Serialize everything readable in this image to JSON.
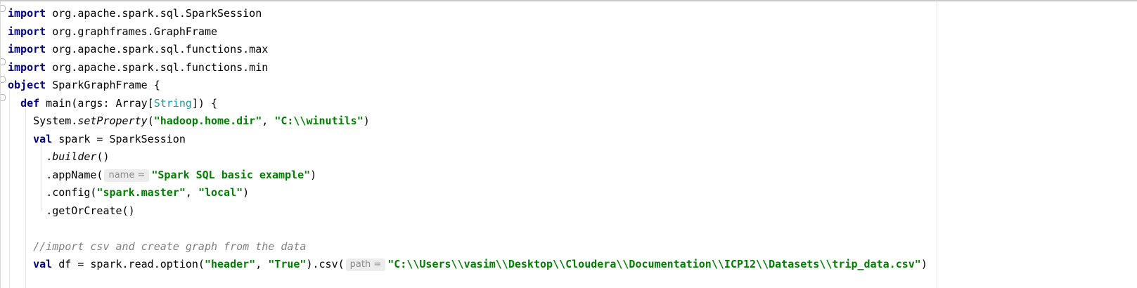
{
  "code": {
    "imports": [
      {
        "keyword": "import",
        "path": " org.apache.spark.sql.SparkSession"
      },
      {
        "keyword": "import",
        "path": " org.graphframes.GraphFrame"
      },
      {
        "keyword": "import",
        "path": " org.apache.spark.sql.functions.max"
      },
      {
        "keyword": "import",
        "path": " org.apache.spark.sql.functions.min"
      }
    ],
    "object_decl": {
      "keyword": "object",
      "name": " SparkGraphFrame {"
    },
    "main_decl": {
      "keyword": "def",
      "signature": " main(args: Array[",
      "type_param": "String",
      "close": "]) {"
    },
    "set_property": {
      "receiver": "System.",
      "method": "setProperty",
      "open": "(",
      "arg1": "\"hadoop.home.dir\"",
      "sep": ", ",
      "arg2": "\"C:\\\\winutils\"",
      "close": ")"
    },
    "val_spark": {
      "keyword": "val",
      "rest": " spark = SparkSession"
    },
    "builder": {
      "dot": ".",
      "method": "builder",
      "rest": "()"
    },
    "app_name": {
      "prefix": ".appName(",
      "hint": "name =",
      "value": "\"Spark SQL basic example\"",
      "close": ")"
    },
    "config": {
      "prefix": ".config(",
      "arg1": "\"spark.master\"",
      "sep": ", ",
      "arg2": "\"local\"",
      "close": ")"
    },
    "get_or_create": ".getOrCreate()",
    "comment": "//import csv and create graph from the data",
    "val_df": {
      "keyword": "val",
      "prefix": " df = spark.read.option(",
      "arg1": "\"header\"",
      "sep": ", ",
      "arg2": "\"True\"",
      "mid": ").csv(",
      "hint": "path =",
      "path": "\"C:\\\\Users\\\\vasim\\\\Desktop\\\\Cloudera\\\\Documentation\\\\ICP12\\\\Datasets\\\\trip_data.csv\"",
      "close": ")"
    }
  },
  "colors": {
    "keyword": "#000080",
    "string": "#008000",
    "comment": "#808080",
    "type_param": "#20999d",
    "hint_background": "#ececec"
  }
}
